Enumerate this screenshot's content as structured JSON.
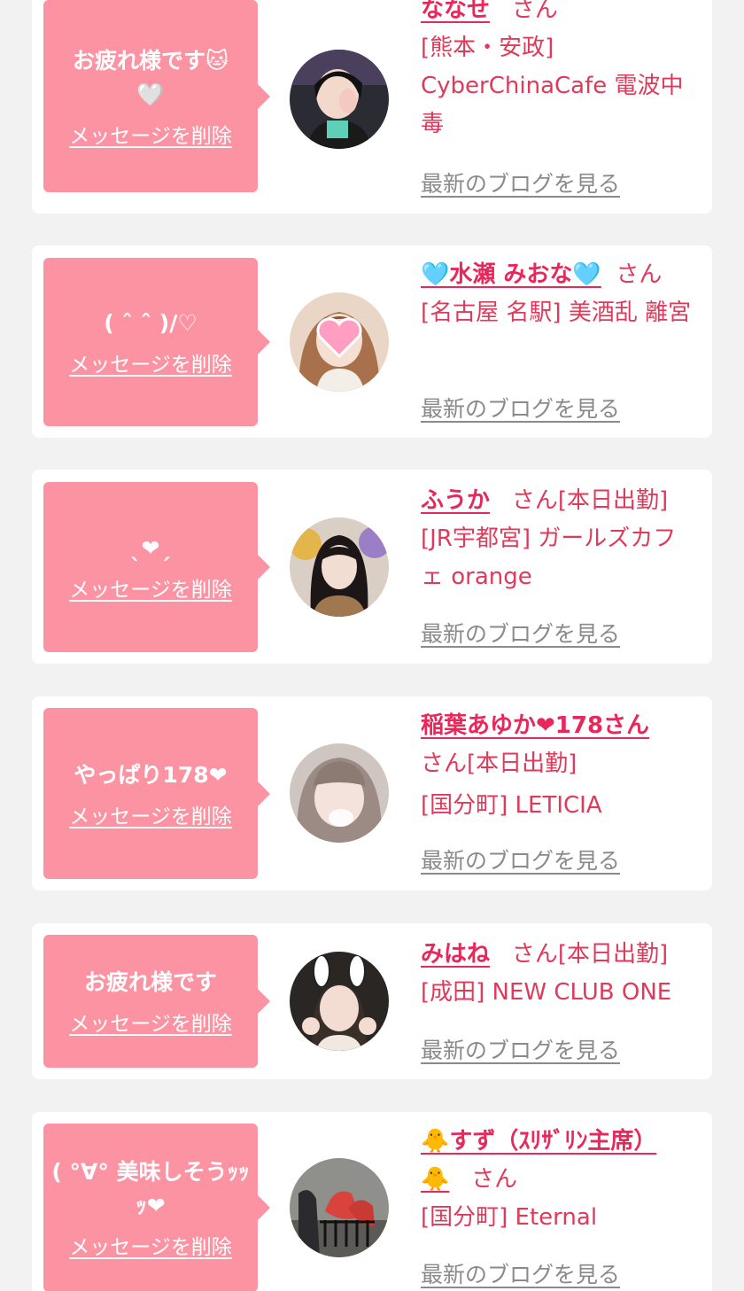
{
  "delete_label": "メッセージを削除",
  "blog_label": "最新のブログを見る",
  "entries": [
    {
      "message": "お疲れ様です🐱🤍",
      "name": "ななせ",
      "suffix": "さん",
      "shop": "[熊本・安政] CyberChinaCafe 電波中毒",
      "avatar_icon": "photo-avatar"
    },
    {
      "message": "( ˆ ˆ )/♡",
      "name": "🩵水瀬 みおな🩵",
      "suffix": "さん",
      "shop": "[名古屋 名駅] 美酒乱 離宮",
      "avatar_icon": "photo-avatar-heart-sticker"
    },
    {
      "message": "ˎ❤ˏ",
      "name": "ふうか",
      "suffix": "さん[本日出勤]",
      "shop": "[JR宇都宮] ガールズカフェ orange",
      "avatar_icon": "photo-avatar"
    },
    {
      "message": "やっぱり178❤",
      "name": "稲葉あゆか❤178さん",
      "suffix": "さん[本日出勤]",
      "shop": "[国分町] LETICIA",
      "avatar_icon": "photo-avatar"
    },
    {
      "message": "お疲れ様です",
      "name": "みはね",
      "suffix": "さん[本日出勤]",
      "shop": "[成田] NEW CLUB ONE",
      "avatar_icon": "photo-avatar-bunny-ears"
    },
    {
      "message": "( °∀° 美味しそうｯｯｯ❤",
      "name": "🐥すず（ｽﾘｻﾞﾘﾝ主席）🐥",
      "suffix": "さん",
      "shop": "[国分町] Eternal",
      "avatar_icon": "photo-avatar"
    }
  ]
}
